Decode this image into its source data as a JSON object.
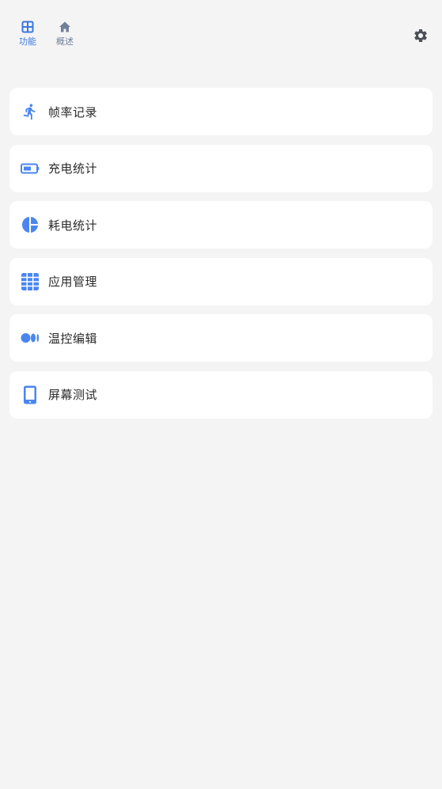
{
  "tabs": [
    {
      "label": "功能",
      "icon": "grid-icon",
      "active": true
    },
    {
      "label": "概述",
      "icon": "home-icon",
      "active": false
    }
  ],
  "settings": {
    "icon": "gear-icon"
  },
  "menu": [
    {
      "label": "帧率记录",
      "icon": "running-person-icon"
    },
    {
      "label": "充电统计",
      "icon": "battery-icon"
    },
    {
      "label": "耗电统计",
      "icon": "pie-chart-icon"
    },
    {
      "label": "应用管理",
      "icon": "apps-grid-icon"
    },
    {
      "label": "温控编辑",
      "icon": "thermal-dots-icon"
    },
    {
      "label": "屏幕测试",
      "icon": "phone-screen-icon"
    }
  ],
  "colors": {
    "accent": "#3a78e0",
    "icon_blue": "#4a86f0",
    "inactive_tab": "#6f7f99",
    "background": "#f4f4f4",
    "card": "#ffffff",
    "gear": "#4b4f58"
  }
}
